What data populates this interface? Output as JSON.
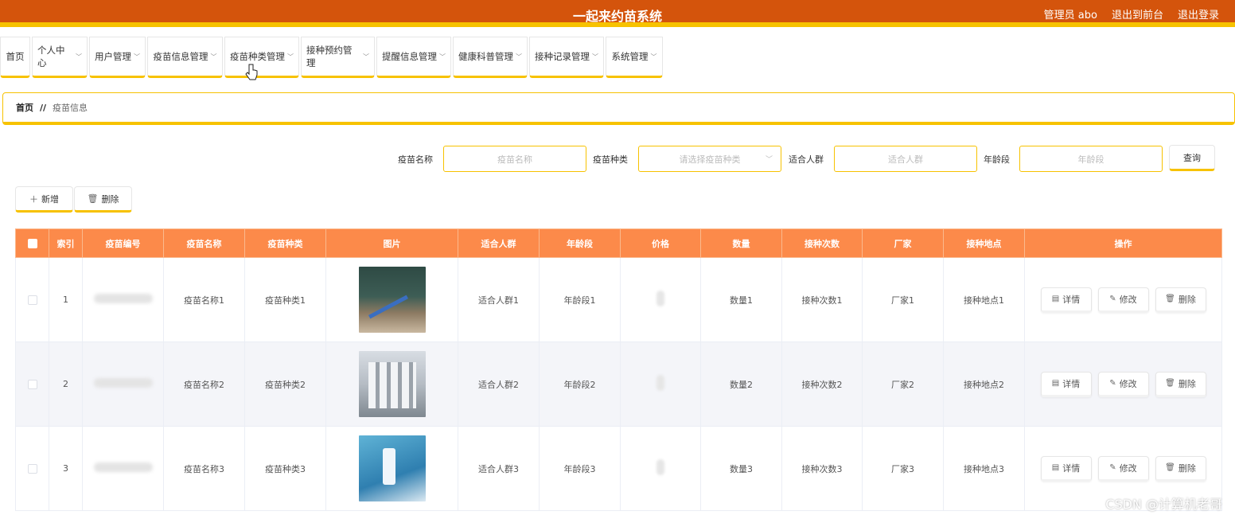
{
  "header": {
    "title": "一起来约苗系统",
    "user": "管理员 abo",
    "front_link": "退出到前台",
    "logout": "退出登录"
  },
  "nav": {
    "items": [
      {
        "label": "首页",
        "has_dropdown": false
      },
      {
        "label": "个人中心",
        "has_dropdown": true
      },
      {
        "label": "用户管理",
        "has_dropdown": true
      },
      {
        "label": "疫苗信息管理",
        "has_dropdown": true
      },
      {
        "label": "疫苗种类管理",
        "has_dropdown": true
      },
      {
        "label": "接种预约管理",
        "has_dropdown": true
      },
      {
        "label": "提醒信息管理",
        "has_dropdown": true
      },
      {
        "label": "健康科普管理",
        "has_dropdown": true
      },
      {
        "label": "接种记录管理",
        "has_dropdown": true
      },
      {
        "label": "系统管理",
        "has_dropdown": true
      }
    ]
  },
  "breadcrumb": {
    "home": "首页",
    "separator": "//",
    "current": "疫苗信息"
  },
  "search": {
    "name_label": "疫苗名称",
    "name_placeholder": "疫苗名称",
    "type_label": "疫苗种类",
    "type_placeholder": "请选择疫苗种类",
    "crowd_label": "适合人群",
    "crowd_placeholder": "适合人群",
    "age_label": "年龄段",
    "age_placeholder": "年龄段",
    "query_button": "查询"
  },
  "actions": {
    "add": "新增",
    "delete": "删除"
  },
  "table": {
    "columns": [
      "索引",
      "疫苗编号",
      "疫苗名称",
      "疫苗种类",
      "图片",
      "适合人群",
      "年龄段",
      "价格",
      "数量",
      "接种次数",
      "厂家",
      "接种地点",
      "操作"
    ],
    "rows": [
      {
        "index": "1",
        "name": "疫苗名称1",
        "type": "疫苗种类1",
        "crowd": "适合人群1",
        "age": "年龄段1",
        "qty": "数量1",
        "times": "接种次数1",
        "maker": "厂家1",
        "place": "接种地点1"
      },
      {
        "index": "2",
        "name": "疫苗名称2",
        "type": "疫苗种类2",
        "crowd": "适合人群2",
        "age": "年龄段2",
        "qty": "数量2",
        "times": "接种次数2",
        "maker": "厂家2",
        "place": "接种地点2"
      },
      {
        "index": "3",
        "name": "疫苗名称3",
        "type": "疫苗种类3",
        "crowd": "适合人群3",
        "age": "年龄段3",
        "qty": "数量3",
        "times": "接种次数3",
        "maker": "厂家3",
        "place": "接种地点3"
      }
    ],
    "row_actions": {
      "detail": "详情",
      "edit": "修改",
      "delete": "删除"
    }
  },
  "watermark": "CSDN @计算机老哥",
  "colors": {
    "header": "#d4540c",
    "accent": "#f7c200",
    "table_header": "#fc8a4a"
  }
}
